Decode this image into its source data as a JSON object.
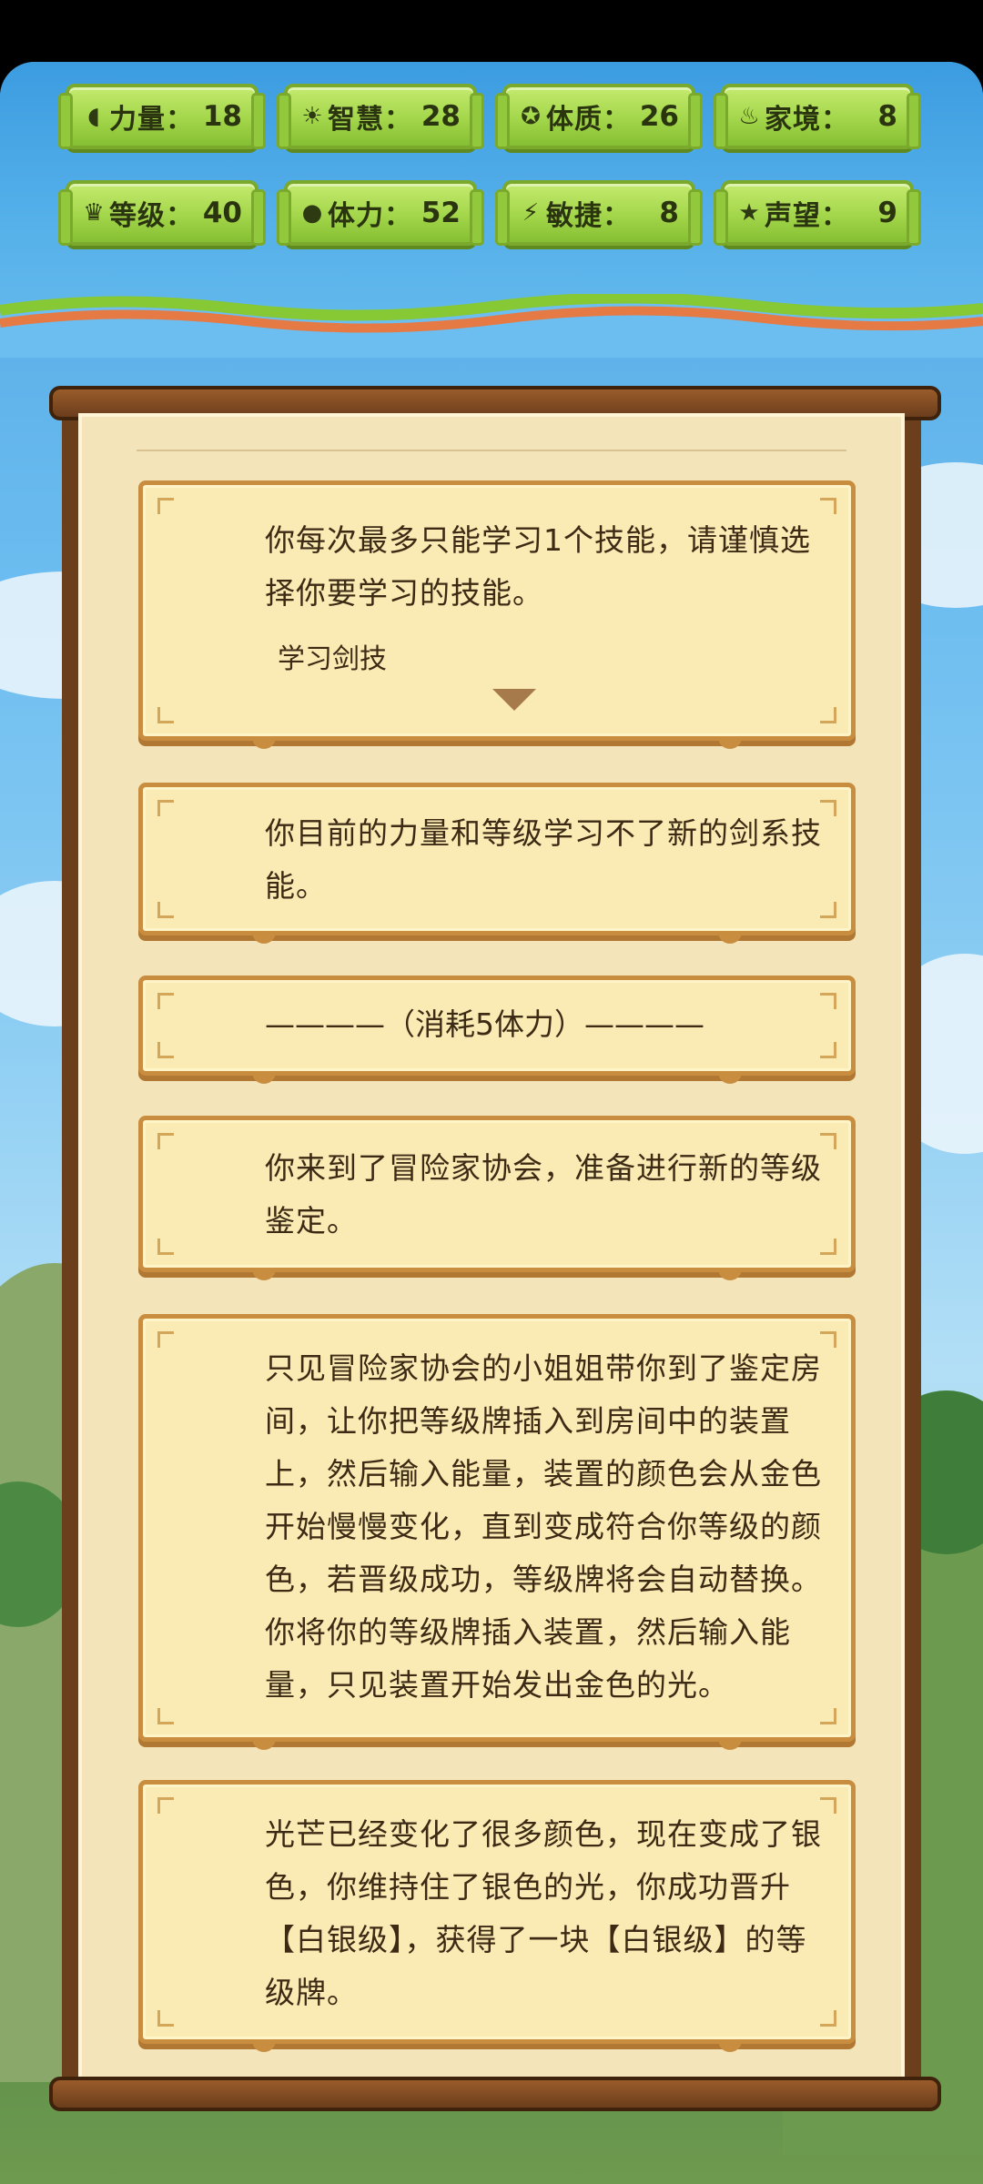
{
  "stats": [
    {
      "icon": "strength-icon",
      "glyph": "◖",
      "label": "力量",
      "value": "18"
    },
    {
      "icon": "wisdom-icon",
      "glyph": "☀",
      "label": "智慧",
      "value": "28"
    },
    {
      "icon": "constitution-icon",
      "glyph": "✪",
      "label": "体质",
      "value": "26"
    },
    {
      "icon": "family-icon",
      "glyph": "♨",
      "label": "家境",
      "value": "8"
    },
    {
      "icon": "level-icon",
      "glyph": "♛",
      "label": "等级",
      "value": "40"
    },
    {
      "icon": "stamina-icon",
      "glyph": "●",
      "label": "体力",
      "value": "52"
    },
    {
      "icon": "agility-icon",
      "glyph": "⚡",
      "label": "敏捷",
      "value": "8"
    },
    {
      "icon": "reputation-icon",
      "glyph": "★",
      "label": "声望",
      "value": "9"
    }
  ],
  "colon": "：",
  "cards": {
    "skill_prompt": "你每次最多只能学习1个技能，请谨慎选择你要学习的技能。",
    "skill_choice": "学习剑技",
    "skill_fail": "你目前的力量和等级学习不了新的剑系技能。",
    "cost_divider": "————（消耗5体力）————",
    "guild_arrive": "你来到了冒险家协会，准备进行新的等级鉴定。",
    "appraisal": "只见冒险家协会的小姐姐带你到了鉴定房间，让你把等级牌插入到房间中的装置上，然后输入能量，装置的颜色会从金色开始慢慢变化，直到变成符合你等级的颜色，若晋级成功，等级牌将会自动替换。你将你的等级牌插入装置，然后输入能量，只见装置开始发出金色的光。",
    "promotion": "光芒已经变化了很多颜色，现在变成了银色，你维持住了银色的光，你成功晋升【白银级】，获得了一块【白银级】的等级牌。"
  }
}
